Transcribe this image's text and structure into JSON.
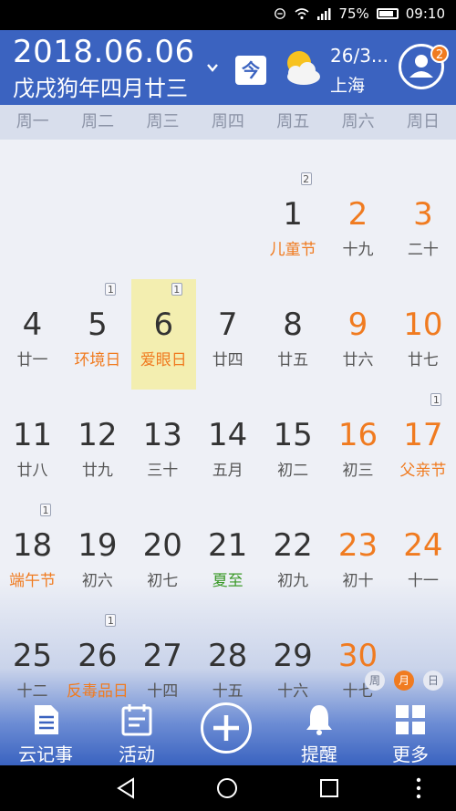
{
  "status": {
    "battery": "75%",
    "time": "09:10"
  },
  "header": {
    "date": "2018.06.06",
    "lunar": "戊戌狗年四月廿三",
    "today_btn": "今",
    "temp": "26/3...",
    "city": "上海",
    "badge": "2"
  },
  "weekdays": [
    "周一",
    "周二",
    "周三",
    "周四",
    "周五",
    "周六",
    "周日"
  ],
  "weeks": [
    [
      null,
      null,
      null,
      null,
      {
        "d": "1",
        "s": "儿童节",
        "hl": true,
        "mark": "2"
      },
      {
        "d": "2",
        "s": "十九",
        "wk": true
      },
      {
        "d": "3",
        "s": "二十",
        "wk": true
      }
    ],
    [
      {
        "d": "4",
        "s": "廿一"
      },
      {
        "d": "5",
        "s": "环境日",
        "hl": true,
        "mark": "1"
      },
      {
        "d": "6",
        "s": "爱眼日",
        "hl": true,
        "mark": "1",
        "sel": true
      },
      {
        "d": "7",
        "s": "廿四"
      },
      {
        "d": "8",
        "s": "廿五"
      },
      {
        "d": "9",
        "s": "廿六",
        "wk": true
      },
      {
        "d": "10",
        "s": "廿七",
        "wk": true
      }
    ],
    [
      {
        "d": "11",
        "s": "廿八"
      },
      {
        "d": "12",
        "s": "廿九"
      },
      {
        "d": "13",
        "s": "三十"
      },
      {
        "d": "14",
        "s": "五月"
      },
      {
        "d": "15",
        "s": "初二"
      },
      {
        "d": "16",
        "s": "初三",
        "wk": true
      },
      {
        "d": "17",
        "s": "父亲节",
        "hl": true,
        "wk": true,
        "mark": "1"
      }
    ],
    [
      {
        "d": "18",
        "s": "端午节",
        "hl": true,
        "mark": "1"
      },
      {
        "d": "19",
        "s": "初六"
      },
      {
        "d": "20",
        "s": "初七"
      },
      {
        "d": "21",
        "s": "夏至",
        "term": true
      },
      {
        "d": "22",
        "s": "初九"
      },
      {
        "d": "23",
        "s": "初十",
        "wk": true
      },
      {
        "d": "24",
        "s": "十一",
        "wk": true
      }
    ],
    [
      {
        "d": "25",
        "s": "十二"
      },
      {
        "d": "26",
        "s": "反毒品日",
        "hl": true,
        "mark": "1"
      },
      {
        "d": "27",
        "s": "十四"
      },
      {
        "d": "28",
        "s": "十五"
      },
      {
        "d": "29",
        "s": "十六"
      },
      {
        "d": "30",
        "s": "十七",
        "wk": true
      },
      null
    ]
  ],
  "views": [
    "周",
    "月",
    "日"
  ],
  "toolbar": {
    "notes": "云记事",
    "activity": "活动",
    "remind": "提醒",
    "more": "更多"
  },
  "colors": {
    "primary": "#3b63c0",
    "accent": "#f07b20",
    "term": "#3c9a2a",
    "selected": "#f3eeb0"
  }
}
